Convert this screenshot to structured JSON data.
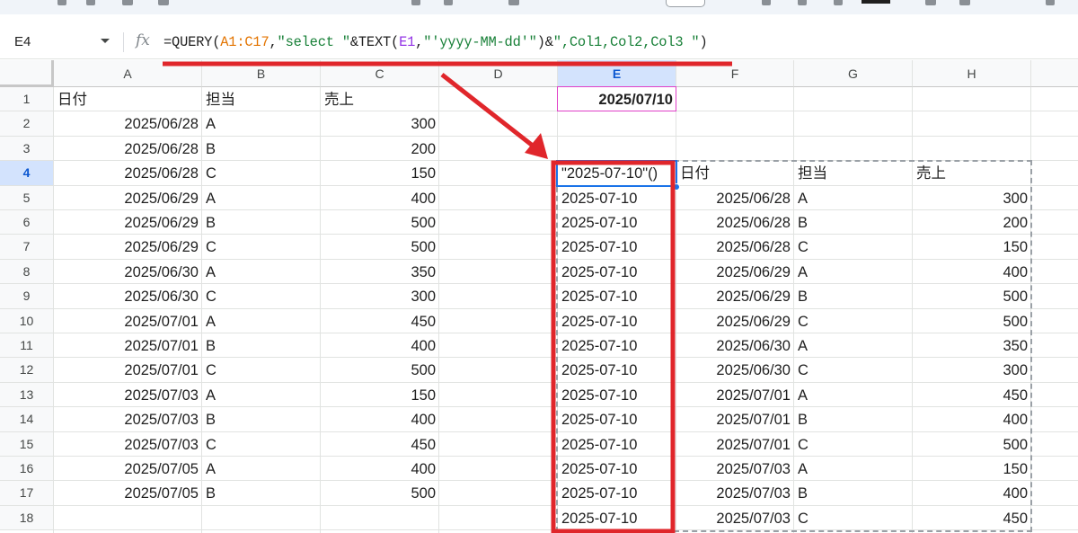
{
  "namebox": {
    "value": "E4"
  },
  "formula": {
    "fx": "fx",
    "parts": [
      {
        "text": "=QUERY(",
        "cls": ""
      },
      {
        "text": "A1:C17",
        "cls": "f-orange"
      },
      {
        "text": ",",
        "cls": ""
      },
      {
        "text": "\"select \"",
        "cls": "f-green"
      },
      {
        "text": "&TEXT(",
        "cls": ""
      },
      {
        "text": "E1",
        "cls": "f-purple"
      },
      {
        "text": ",",
        "cls": ""
      },
      {
        "text": "\"'yyyy-MM-dd'\"",
        "cls": "f-green"
      },
      {
        "text": ")&",
        "cls": ""
      },
      {
        "text": "\",Col1,Col2,Col3 \"",
        "cls": "f-green"
      },
      {
        "text": ")",
        "cls": ""
      }
    ]
  },
  "columns": [
    "A",
    "B",
    "C",
    "D",
    "E",
    "F",
    "G",
    "H"
  ],
  "selected_column": "E",
  "rows": [
    "1",
    "2",
    "3",
    "4",
    "5",
    "6",
    "7",
    "8",
    "9",
    "10",
    "11",
    "12",
    "13",
    "14",
    "15",
    "16",
    "17",
    "18"
  ],
  "selected_row": "4",
  "source_header": [
    "日付",
    "担当",
    "売上"
  ],
  "source_rows": [
    [
      "2025/06/28",
      "A",
      "300"
    ],
    [
      "2025/06/28",
      "B",
      "200"
    ],
    [
      "2025/06/28",
      "C",
      "150"
    ],
    [
      "2025/06/29",
      "A",
      "400"
    ],
    [
      "2025/06/29",
      "B",
      "500"
    ],
    [
      "2025/06/29",
      "C",
      "500"
    ],
    [
      "2025/06/30",
      "A",
      "350"
    ],
    [
      "2025/06/30",
      "C",
      "300"
    ],
    [
      "2025/07/01",
      "A",
      "450"
    ],
    [
      "2025/07/01",
      "B",
      "400"
    ],
    [
      "2025/07/01",
      "C",
      "500"
    ],
    [
      "2025/07/03",
      "A",
      "150"
    ],
    [
      "2025/07/03",
      "B",
      "400"
    ],
    [
      "2025/07/03",
      "C",
      "450"
    ],
    [
      "2025/07/05",
      "A",
      "400"
    ],
    [
      "2025/07/05",
      "B",
      "500"
    ]
  ],
  "e1_value": "2025/07/10",
  "result_header": [
    "\"2025-07-10\"()",
    "日付",
    "担当",
    "売上"
  ],
  "result_rows": [
    [
      "2025-07-10",
      "2025/06/28",
      "A",
      "300"
    ],
    [
      "2025-07-10",
      "2025/06/28",
      "B",
      "200"
    ],
    [
      "2025-07-10",
      "2025/06/28",
      "C",
      "150"
    ],
    [
      "2025-07-10",
      "2025/06/29",
      "A",
      "400"
    ],
    [
      "2025-07-10",
      "2025/06/29",
      "B",
      "500"
    ],
    [
      "2025-07-10",
      "2025/06/29",
      "C",
      "500"
    ],
    [
      "2025-07-10",
      "2025/06/30",
      "A",
      "350"
    ],
    [
      "2025-07-10",
      "2025/06/30",
      "C",
      "300"
    ],
    [
      "2025-07-10",
      "2025/07/01",
      "A",
      "450"
    ],
    [
      "2025-07-10",
      "2025/07/01",
      "B",
      "400"
    ],
    [
      "2025-07-10",
      "2025/07/01",
      "C",
      "500"
    ],
    [
      "2025-07-10",
      "2025/07/03",
      "A",
      "150"
    ],
    [
      "2025-07-10",
      "2025/07/03",
      "B",
      "400"
    ],
    [
      "2025-07-10",
      "2025/07/03",
      "C",
      "450"
    ]
  ],
  "colors": {
    "annotation_red": "#e0262b",
    "selection_blue": "#1a73e8",
    "header_selected_bg": "#d3e3fd",
    "e1_border": "#e040c8"
  }
}
